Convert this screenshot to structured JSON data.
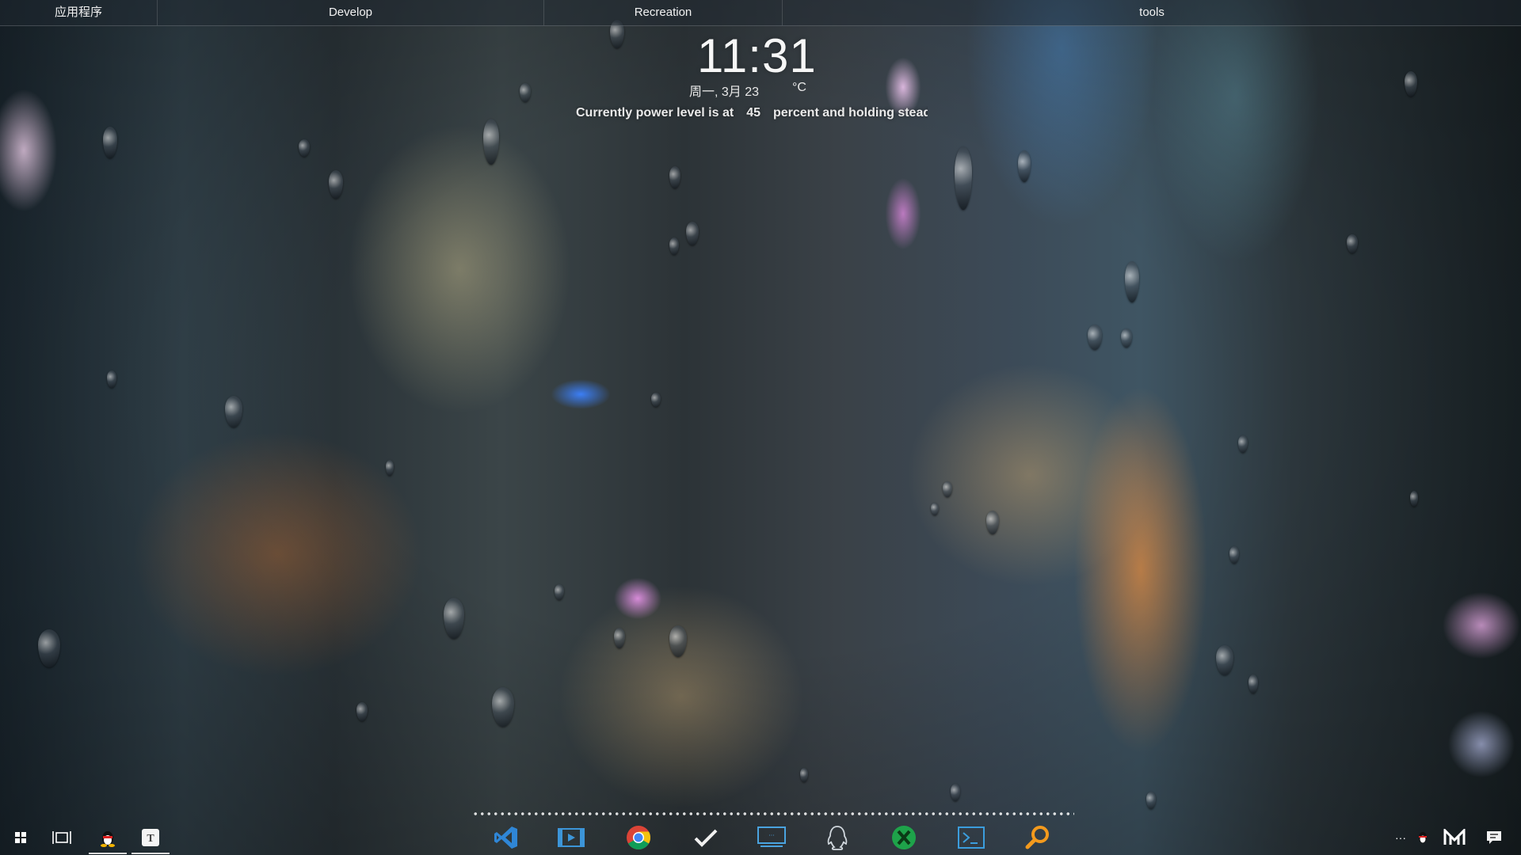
{
  "topbar": {
    "menus": [
      "应用程序",
      "Develop",
      "Recreation",
      "tools"
    ]
  },
  "widget": {
    "time": "11:31",
    "date": "周一, 3月 23",
    "temperature_unit": "°C",
    "power_prefix": "Currently power level is at",
    "power_value": "45",
    "power_suffix": "percent and holding steady"
  },
  "taskbar": {
    "left_icons": [
      "start-icon",
      "task-view-icon",
      "qq-penguin-icon",
      "typora-icon"
    ],
    "dock_icons": [
      "vscode-icon",
      "video-editor-icon",
      "chrome-icon",
      "todo-check-icon",
      "remote-desktop-icon",
      "qq-icon",
      "xshell-icon",
      "terminal-icon",
      "search-everything-icon"
    ],
    "tray_icons": [
      "overflow-icon",
      "qq-tray-icon",
      "m-app-icon",
      "notification-icon"
    ],
    "tray_overflow_label": "···"
  },
  "colors": {
    "vscode": "#2f86d6",
    "chrome_red": "#db4437",
    "chrome_yellow": "#f4c20d",
    "chrome_green": "#0f9d58",
    "chrome_blue": "#4285f4",
    "search": "#f39a1d",
    "remote": "#4aa3df",
    "xshell": "#1ea34a"
  }
}
